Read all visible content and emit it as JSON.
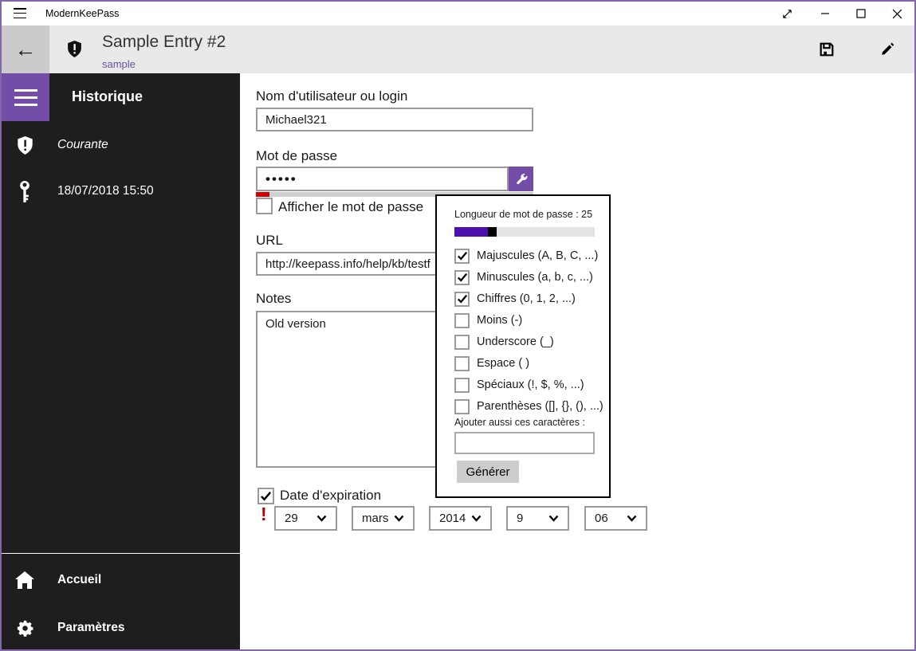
{
  "titlebar": {
    "app_title": "ModernKeePass"
  },
  "header": {
    "title": "Sample Entry #2",
    "subtitle": "sample"
  },
  "sidebar": {
    "heading": "Historique",
    "items": [
      {
        "label": "Courante"
      },
      {
        "label": "18/07/2018 15:50"
      }
    ],
    "footer_items": [
      {
        "label": "Accueil"
      },
      {
        "label": "Paramètres"
      }
    ]
  },
  "form": {
    "username_label": "Nom d'utilisateur ou login",
    "username_value": "Michael321",
    "password_label": "Mot de passe",
    "password_value": "•••••",
    "show_password_label": "Afficher le mot de passe",
    "show_password_checked": false,
    "url_label": "URL",
    "url_value": "http://keepass.info/help/kb/testf",
    "notes_label": "Notes",
    "notes_value": "Old version",
    "expiration_label": "Date d'expiration",
    "expiration_checked": true,
    "expiration_warning": "!",
    "date_values": [
      "29",
      "mars",
      "2014",
      "9",
      "06"
    ]
  },
  "generator": {
    "length_label": "Longueur de mot de passe : 25",
    "length_value": 25,
    "options": [
      {
        "label": "Majuscules (A, B, C, ...)",
        "checked": true
      },
      {
        "label": "Minuscules (a, b, c, ...)",
        "checked": true
      },
      {
        "label": "Chiffres (0, 1, 2, ...)",
        "checked": true
      },
      {
        "label": "Moins (-)",
        "checked": false
      },
      {
        "label": "Underscore (_)",
        "checked": false
      },
      {
        "label": "Espace ( )",
        "checked": false
      },
      {
        "label": "Spéciaux (!, $, %, ...)",
        "checked": false
      },
      {
        "label": "Parenthèses ([], {}, (), ...)",
        "checked": false
      }
    ],
    "extra_chars_label": "Ajouter aussi ces caractères :",
    "extra_chars_value": "",
    "generate_label": "Générer"
  },
  "colors": {
    "accent_purple": "#744da9",
    "window_border_purple": "#8268ab",
    "slider_fill_purple": "#4b10ae",
    "strength_red": "#d40000",
    "warning_red": "#b30000",
    "link_purple": "#6a51a3",
    "sidebar_bg": "#1e1e1e",
    "header_bg": "#e9e9e9"
  }
}
